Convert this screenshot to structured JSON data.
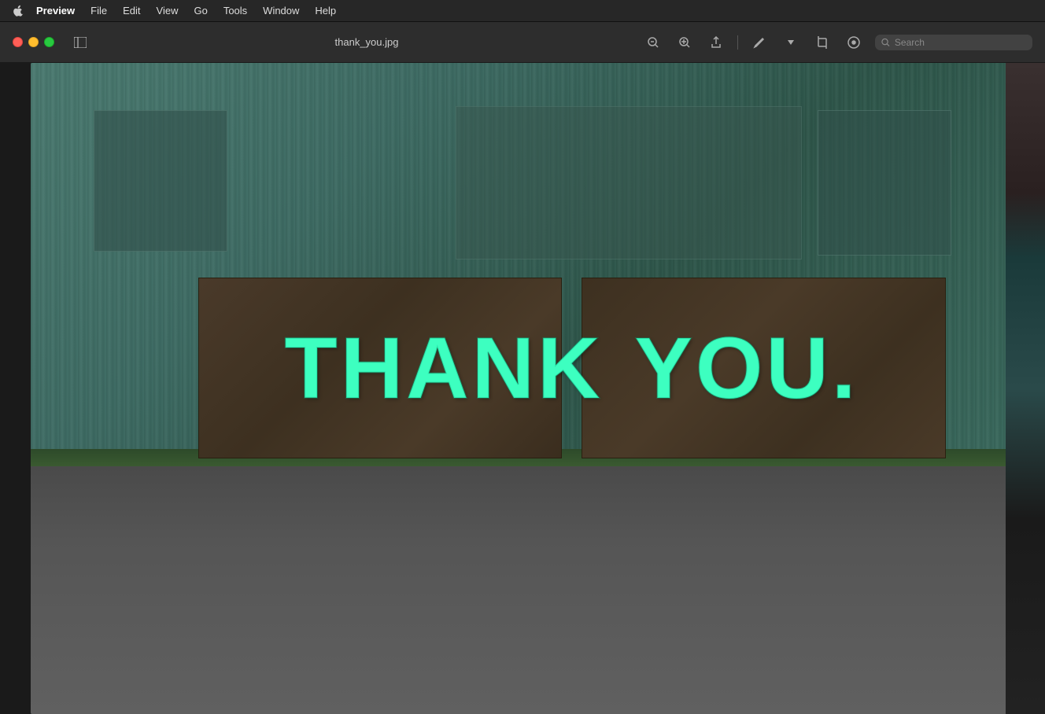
{
  "menubar": {
    "apple_symbol": "",
    "items": [
      {
        "label": "Preview",
        "active": true
      },
      {
        "label": "File"
      },
      {
        "label": "Edit"
      },
      {
        "label": "View"
      },
      {
        "label": "Go"
      },
      {
        "label": "Tools"
      },
      {
        "label": "Window"
      },
      {
        "label": "Help"
      }
    ]
  },
  "toolbar": {
    "traffic_lights": {
      "close": "close",
      "minimize": "minimize",
      "maximize": "maximize"
    },
    "filename": "thank_you.jpg",
    "icons": {
      "zoom_out": "−",
      "zoom_in": "+",
      "share": "⬆",
      "markup": "✏",
      "crop": "⊡",
      "adjust": "⊕"
    },
    "search_placeholder": "Search"
  },
  "photo": {
    "filename": "thank_you.jpg",
    "sign_text_left": "THANK",
    "sign_text_right": "YOU.",
    "background_color": "#3d6b63"
  }
}
